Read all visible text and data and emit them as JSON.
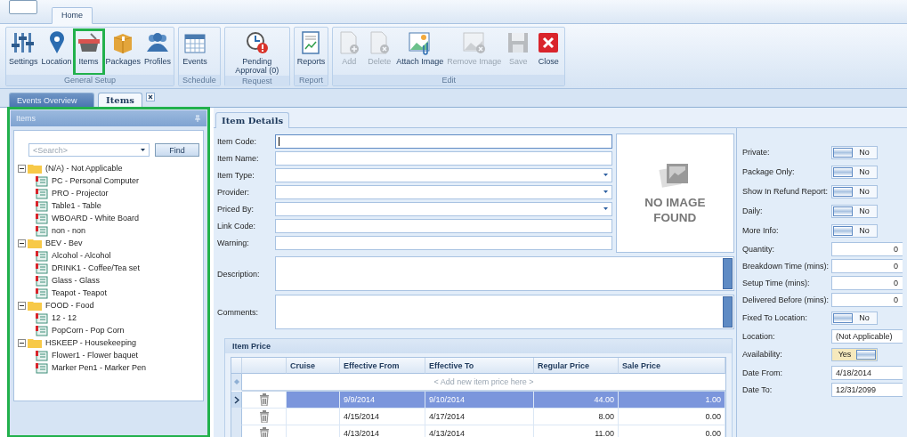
{
  "app_tabs": [
    {
      "label": "Home",
      "selected": true
    }
  ],
  "ribbon": {
    "groups": [
      {
        "label": "General Setup",
        "buttons": [
          {
            "label": "Settings",
            "kind": "sliders",
            "disabled": false,
            "highlighted": false
          },
          {
            "label": "Location",
            "kind": "pin",
            "disabled": false,
            "highlighted": false
          },
          {
            "label": "Items",
            "kind": "basket",
            "disabled": false,
            "highlighted": true
          },
          {
            "label": "Packages",
            "kind": "box",
            "disabled": false,
            "highlighted": false
          },
          {
            "label": "Profiles",
            "kind": "people",
            "disabled": false,
            "highlighted": false
          }
        ]
      },
      {
        "label": "Schedule",
        "buttons": [
          {
            "label": "Events",
            "kind": "calendar",
            "disabled": false,
            "highlighted": false
          }
        ]
      },
      {
        "label": "Request",
        "buttons": [
          {
            "label": "Pending Approval (0)",
            "kind": "clock",
            "disabled": false,
            "highlighted": false
          }
        ]
      },
      {
        "label": "Report",
        "buttons": [
          {
            "label": "Reports",
            "kind": "report",
            "disabled": false,
            "highlighted": false
          }
        ]
      },
      {
        "label": "Edit",
        "buttons": [
          {
            "label": "Add",
            "kind": "add",
            "disabled": true,
            "highlighted": false
          },
          {
            "label": "Delete",
            "kind": "delete",
            "disabled": true,
            "highlighted": false
          },
          {
            "label": "Attach Image",
            "kind": "attach",
            "disabled": false,
            "highlighted": false
          },
          {
            "label": "Remove Image",
            "kind": "remove",
            "disabled": true,
            "highlighted": false
          },
          {
            "label": "Save",
            "kind": "save",
            "disabled": true,
            "highlighted": false
          },
          {
            "label": "Close",
            "kind": "close",
            "disabled": false,
            "highlighted": false
          }
        ]
      }
    ]
  },
  "doc_tabs": [
    {
      "label": "Events Overview",
      "selected": false,
      "closable": false
    },
    {
      "label": "Items",
      "selected": true,
      "closable": true
    }
  ],
  "items_panel": {
    "title": "Items",
    "highlighted": true,
    "search": {
      "placeholder": "<Search>"
    },
    "find_button": "Find",
    "tree": [
      {
        "label": "(N/A) - Not Applicable",
        "expanded": true,
        "children": [
          {
            "label": "PC - Personal Computer"
          },
          {
            "label": "PRO - Projector"
          },
          {
            "label": "Table1 - Table"
          },
          {
            "label": "WBOARD - White Board"
          },
          {
            "label": "non - non"
          }
        ]
      },
      {
        "label": "BEV - Bev",
        "expanded": true,
        "children": [
          {
            "label": "Alcohol - Alcohol"
          },
          {
            "label": "DRINK1 - Coffee/Tea set"
          },
          {
            "label": "Glass - Glass"
          },
          {
            "label": "Teapot - Teapot"
          }
        ]
      },
      {
        "label": "FOOD - Food",
        "expanded": true,
        "children": [
          {
            "label": "12 - 12"
          },
          {
            "label": "PopCorn - Pop Corn"
          }
        ]
      },
      {
        "label": "HSKEEP - Housekeeping",
        "expanded": true,
        "children": [
          {
            "label": "Flower1 - Flower baquet"
          },
          {
            "label": "Marker Pen1 - Marker Pen"
          }
        ]
      }
    ]
  },
  "detail_tabs": [
    {
      "label": "Item Details",
      "selected": true
    }
  ],
  "form": {
    "fields": [
      {
        "label": "Item Code:",
        "kind": "text",
        "focused": true
      },
      {
        "label": "Item Name:",
        "kind": "text",
        "focused": false
      },
      {
        "label": "Item Type:",
        "kind": "dropdown",
        "focused": false
      },
      {
        "label": "Provider:",
        "kind": "dropdown",
        "focused": false
      },
      {
        "label": "Priced By:",
        "kind": "dropdown",
        "focused": false
      },
      {
        "label": "Link Code:",
        "kind": "text",
        "focused": false
      },
      {
        "label": "Warning:",
        "kind": "text",
        "focused": false
      },
      {
        "label": "Description:",
        "kind": "memo",
        "focused": false
      },
      {
        "label": "Comments:",
        "kind": "memo",
        "focused": false
      }
    ],
    "image_placeholder": {
      "text": "NO IMAGE FOUND"
    }
  },
  "properties": [
    {
      "label": "Private:",
      "kind": "toggle",
      "on": false,
      "value": "No"
    },
    {
      "label": "Package Only:",
      "kind": "toggle",
      "on": false,
      "value": "No"
    },
    {
      "label": "Show In Refund Report:",
      "kind": "toggle",
      "on": false,
      "value": "No"
    },
    {
      "label": "Daily:",
      "kind": "toggle",
      "on": false,
      "value": "No"
    },
    {
      "label": "More Info:",
      "kind": "toggle",
      "on": false,
      "value": "No"
    },
    {
      "label": "Quantity:",
      "kind": "number",
      "value": "0"
    },
    {
      "label": "Breakdown Time (mins):",
      "kind": "number",
      "value": "0"
    },
    {
      "label": "Setup Time (mins):",
      "kind": "number",
      "value": "0"
    },
    {
      "label": "Delivered Before (mins):",
      "kind": "number",
      "value": "0"
    },
    {
      "label": "Fixed To Location:",
      "kind": "toggle",
      "on": false,
      "value": "No"
    },
    {
      "label": "Location:",
      "kind": "dropdown",
      "value": "(Not Applicable)"
    },
    {
      "label": "Availability:",
      "kind": "toggle",
      "on": true,
      "value": "Yes"
    },
    {
      "label": "Date From:",
      "kind": "dropdown",
      "value": "4/18/2014"
    },
    {
      "label": "Date To:",
      "kind": "dropdown",
      "value": "12/31/2099"
    }
  ],
  "item_price": {
    "title": "Item Price",
    "columns": [
      "Cruise",
      "Effective From",
      "Effective To",
      "Regular Price",
      "Sale Price"
    ],
    "new_row_hint": "< Add new item price here >",
    "rows": [
      {
        "selected": true,
        "cells": [
          "",
          "9/9/2014",
          "9/10/2014",
          "44.00",
          "1.00"
        ]
      },
      {
        "selected": false,
        "cells": [
          "",
          "4/15/2014",
          "4/17/2014",
          "8.00",
          "0.00"
        ]
      },
      {
        "selected": false,
        "cells": [
          "",
          "4/13/2014",
          "4/13/2014",
          "11.00",
          "0.00"
        ]
      }
    ]
  }
}
